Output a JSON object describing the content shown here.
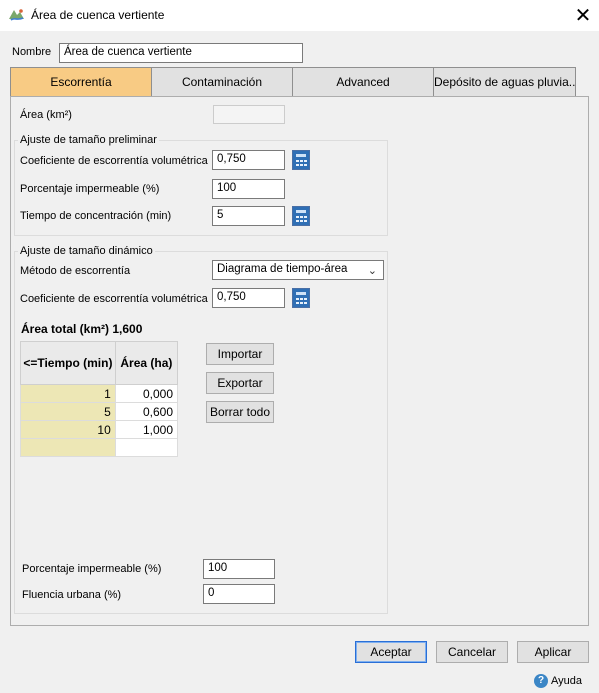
{
  "window": {
    "title": "Área de cuenca vertiente",
    "close_glyph": "✕"
  },
  "name_field": {
    "label": "Nombre",
    "value": "Área de cuenca vertiente"
  },
  "tabs": [
    {
      "label": "Escorrentía",
      "active": true
    },
    {
      "label": "Contaminación",
      "active": false
    },
    {
      "label": "Advanced",
      "active": false
    },
    {
      "label": "Depósito de aguas pluvia...",
      "active": false
    }
  ],
  "area": {
    "label": "Área (km²)",
    "value": ""
  },
  "preliminary": {
    "title": "Ajuste de tamaño preliminar",
    "runoff_coef": {
      "label": "Coeficiente de escorrentía volumétrica",
      "value": "0,750"
    },
    "impervious": {
      "label": "Porcentaje impermeable (%)",
      "value": "100"
    },
    "concentration": {
      "label": "Tiempo de concentración (min)",
      "value": "5"
    }
  },
  "dynamic": {
    "title": "Ajuste de tamaño dinámico",
    "method": {
      "label": "Método de escorrentía",
      "value": "Diagrama de tiempo-área"
    },
    "runoff_coef": {
      "label": "Coeficiente de escorrentía volumétrica",
      "value": "0,750"
    },
    "total_area": {
      "label": "Área total (km²)",
      "value": "1,600"
    },
    "table": {
      "headers": [
        "<=Tiempo (min)",
        "Área (ha)"
      ],
      "rows": [
        {
          "time": "1",
          "area": "0,000"
        },
        {
          "time": "5",
          "area": "0,600"
        },
        {
          "time": "10",
          "area": "1,000"
        },
        {
          "time": "",
          "area": ""
        }
      ]
    },
    "buttons": {
      "import": "Importar",
      "export": "Exportar",
      "clear": "Borrar todo"
    }
  },
  "bottom": {
    "impervious": {
      "label": "Porcentaje impermeable (%)",
      "value": "100"
    },
    "urban_creep": {
      "label": "Fluencia urbana (%)",
      "value": "0"
    }
  },
  "footer": {
    "ok": "Aceptar",
    "cancel": "Cancelar",
    "apply": "Aplicar",
    "help": "Ayuda",
    "help_glyph": "?"
  },
  "colors": {
    "active_tab": "#f8cb84",
    "time_cells": "#ede7b5",
    "calculator": "#2f6fb5"
  },
  "icons": [
    "app-icon",
    "close-icon",
    "calculator-icon",
    "chevron-down-icon",
    "help-icon"
  ]
}
